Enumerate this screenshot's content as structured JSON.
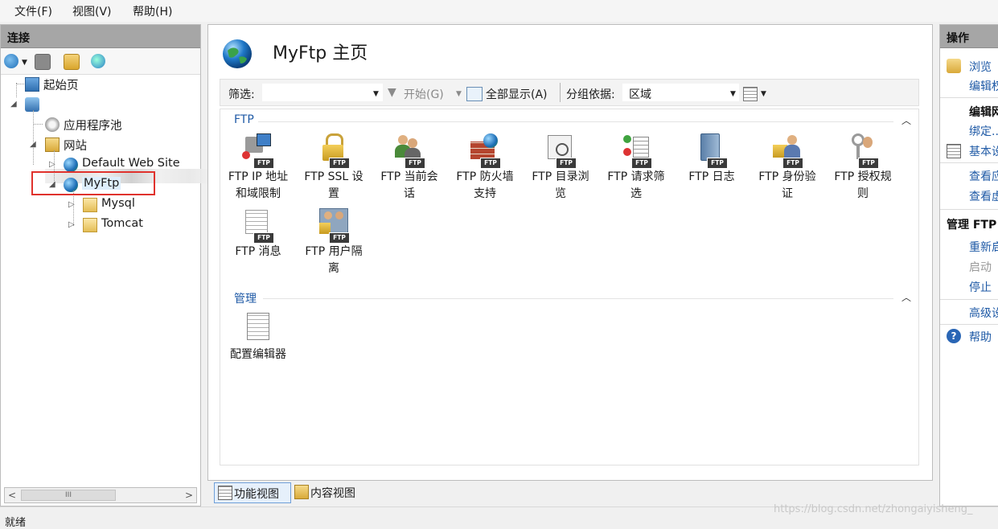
{
  "menu": {
    "file": "文件(F)",
    "view": "视图(V)",
    "help": "帮助(H)"
  },
  "left": {
    "header": "连接",
    "tree": {
      "start_page": "起始页",
      "app_pools": "应用程序池",
      "sites": "网站",
      "default_site": "Default Web Site",
      "myftp": "MyFtp",
      "mysql": "Mysql",
      "tomcat": "Tomcat"
    },
    "scroll_thumb": "III"
  },
  "center": {
    "title": "MyFtp 主页",
    "filter_label": "筛选:",
    "start_label": "开始(G)",
    "show_all_label": "全部显示(A)",
    "group_by_label": "分组依据:",
    "group_by_value": "区域",
    "sections": {
      "ftp": "FTP",
      "manage": "管理"
    },
    "features": [
      {
        "name": "FTP IP 地址和域限制",
        "l1": "FTP IP 地址",
        "l2": "和域限制"
      },
      {
        "name": "FTP SSL 设置",
        "l1": "FTP SSL 设",
        "l2": "置"
      },
      {
        "name": "FTP 当前会话",
        "l1": "FTP 当前会",
        "l2": "话"
      },
      {
        "name": "FTP 防火墙支持",
        "l1": "FTP 防火墙",
        "l2": "支持"
      },
      {
        "name": "FTP 目录浏览",
        "l1": "FTP 目录浏",
        "l2": "览"
      },
      {
        "name": "FTP 请求筛选",
        "l1": "FTP 请求筛",
        "l2": "选"
      },
      {
        "name": "FTP 日志",
        "l1": "FTP 日志",
        "l2": ""
      },
      {
        "name": "FTP 身份验证",
        "l1": "FTP 身份验",
        "l2": "证"
      },
      {
        "name": "FTP 授权规则",
        "l1": "FTP 授权规",
        "l2": "则"
      },
      {
        "name": "FTP 消息",
        "l1": "FTP 消息",
        "l2": ""
      },
      {
        "name": "FTP 用户隔离",
        "l1": "FTP 用户隔",
        "l2": "离"
      }
    ],
    "config_editor": "配置编辑器",
    "ftp_badge": "FTP"
  },
  "view_tabs": {
    "features": "功能视图",
    "content": "内容视图"
  },
  "right": {
    "header": "操作",
    "browse": "浏览",
    "edit1": "编辑权",
    "edit_site_head": "编辑网",
    "bind": "绑定...",
    "basic": "基本设",
    "view_app": "查看应",
    "view_vdir": "查看虚",
    "manage_head": "管理 FTP",
    "restart": "重新启",
    "start": "启动",
    "stop": "停止",
    "advanced": "高级设",
    "help": "帮助"
  },
  "status": "就绪",
  "watermark": "https://blog.csdn.net/zhongaiyisheng_"
}
